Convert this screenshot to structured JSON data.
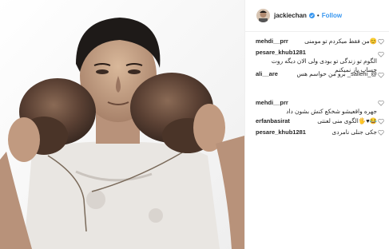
{
  "header": {
    "username": "jackiechan",
    "separator": "•",
    "follow_label": "Follow"
  },
  "comments": [
    {
      "user": "mehdi__prr",
      "text": "😊من فقط میکردم تو مومنی"
    },
    {
      "user": "pesare_khub1281",
      "text": "الگوم تو زندگی تو بودی ولی الان دیگه روت حساب باز نمیکنم"
    },
    {
      "user": "ali__are",
      "text": "@_sallehi_ برو من حواسم هس"
    },
    {
      "user": "mehdi__prr",
      "text": "جهره واقعیشو شخکع کنش بشون داد"
    },
    {
      "user": "erfanbasirat",
      "text": "😂♥🖐الگوی منی لعنتی"
    },
    {
      "user": "pesare_khub1281",
      "text": "جکی جنلی نامردی"
    }
  ],
  "colors": {
    "accent": "#3897f0",
    "verified": "#3897f0",
    "text": "#262626",
    "border": "#efefef"
  },
  "icons": [
    "verified-badge-icon",
    "heart-icon"
  ]
}
